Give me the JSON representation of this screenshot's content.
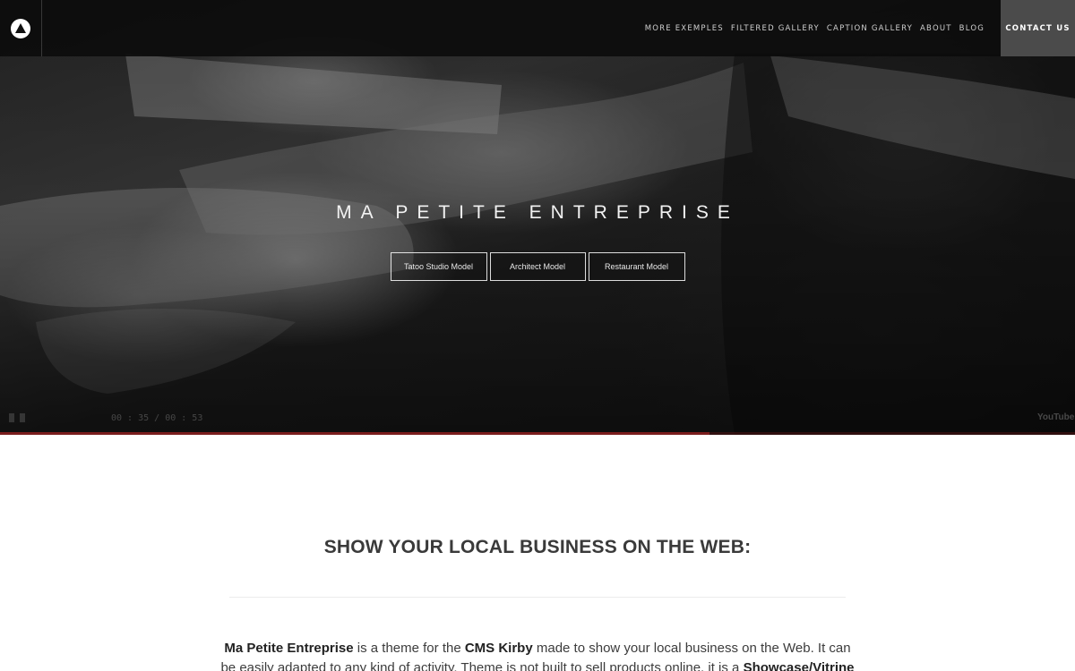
{
  "nav": {
    "logo_icon": "triangle-circle-logo",
    "links": [
      {
        "label": "MORE EXEMPLES"
      },
      {
        "label": "FILTERED GALLERY"
      },
      {
        "label": "CAPTION GALLERY"
      },
      {
        "label": "ABOUT"
      },
      {
        "label": "BLOG"
      }
    ],
    "contact_label": "CONTACT US"
  },
  "hero": {
    "title": "MA PETITE ENTREPRISE",
    "buttons": [
      {
        "label": "Tatoo Studio Model"
      },
      {
        "label": "Architect Model"
      },
      {
        "label": "Restaurant Model"
      }
    ],
    "video": {
      "time": "00 : 35 / 00 : 53",
      "progress": 0.66,
      "platform": "YouTube"
    }
  },
  "content": {
    "section_title": "SHOW YOUR LOCAL BUSINESS ON THE WEB:",
    "intro": {
      "name": "Ma Petite Entreprise",
      "text_1": " is a theme for the ",
      "cms": "CMS Kirby",
      "text_2": " made to show your local business on the Web. It can be easily adapted to any kind of activity. Theme is not built to sell products online, it is a ",
      "showcase": "Showcase/Vitrine"
    }
  },
  "colors": {
    "nav_bg": "#0c0c0c",
    "contact_bg": "#4b4b4b",
    "progress": "#7a1d1d"
  }
}
